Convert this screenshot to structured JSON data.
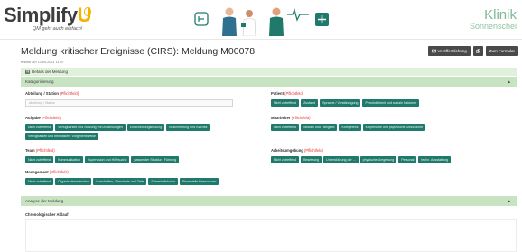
{
  "header": {
    "logo_main": "Simplify",
    "logo_u": "U",
    "logo_tagline": "QM geht auch einfach!",
    "brand_line1": "Klinik",
    "brand_line2": "Sonnenschei"
  },
  "page": {
    "title": "Meldung kritischer Ereignisse (CIRS): Meldung M00078",
    "meta": "erstellt am 13.09.2021 11:07"
  },
  "actions": {
    "publish_label": "Veröffentlichung",
    "close_label": "Zum Formular"
  },
  "sections": {
    "details_label": "Details der Meldung",
    "kategorisierung_label": "Kategorisierung",
    "analyse_label": "Analyse der Meldung"
  },
  "required_marker": "(Pflichtfeld)",
  "fields": {
    "abteilung": {
      "label": "Abteilung / Station",
      "placeholder": "Abteilung / Station"
    },
    "aufgabe": {
      "label": "Aufgabe",
      "chips": [
        "Nicht zutreffend",
        "Verfügbarkeit und Nutzung von Anweisungen",
        "Entscheidungsfindung",
        "Beschreibung und Klarheit",
        "Verfügbarkeit und bewusstere Vorgehensweise"
      ]
    },
    "team": {
      "label": "Team",
      "chips": [
        "Nicht zutreffend",
        "Kommunikation",
        "Supervision und Hilfesuche",
        "passender Struktur / Führung"
      ]
    },
    "management": {
      "label": "Management",
      "chips": [
        "Nicht zutreffend",
        "Organisationsstruktur",
        "Vorschriften, Standards und Ziele",
        "Sicherheitskultur",
        "Finanzielle Ressourcen"
      ]
    },
    "patient": {
      "label": "Patient",
      "chips": [
        "Nicht zutreffend",
        "Zustand",
        "Sprache / Verständigung",
        "Persönlichkeit und soziale Faktoren"
      ]
    },
    "mitarbeiter": {
      "label": "Mitarbeiter",
      "chips": [
        "Nicht zutreffend",
        "Wissen und Fähigkeit",
        "Kompetenz",
        "Körperliche und psychische Gesundheit"
      ]
    },
    "arbeitsumgebung": {
      "label": "Arbeitsumgebung",
      "chips": [
        "Nicht zutreffend",
        "Besetzung",
        "Unterstützung der ...",
        "physische Umgebung",
        "Personal",
        "techn. Ausstattung"
      ]
    },
    "chrono_label": "Chronologischer Ablauf"
  },
  "colors": {
    "chip": "#1f7a6b",
    "section_bar": "#c7e3c2",
    "required": "#e0342f"
  }
}
